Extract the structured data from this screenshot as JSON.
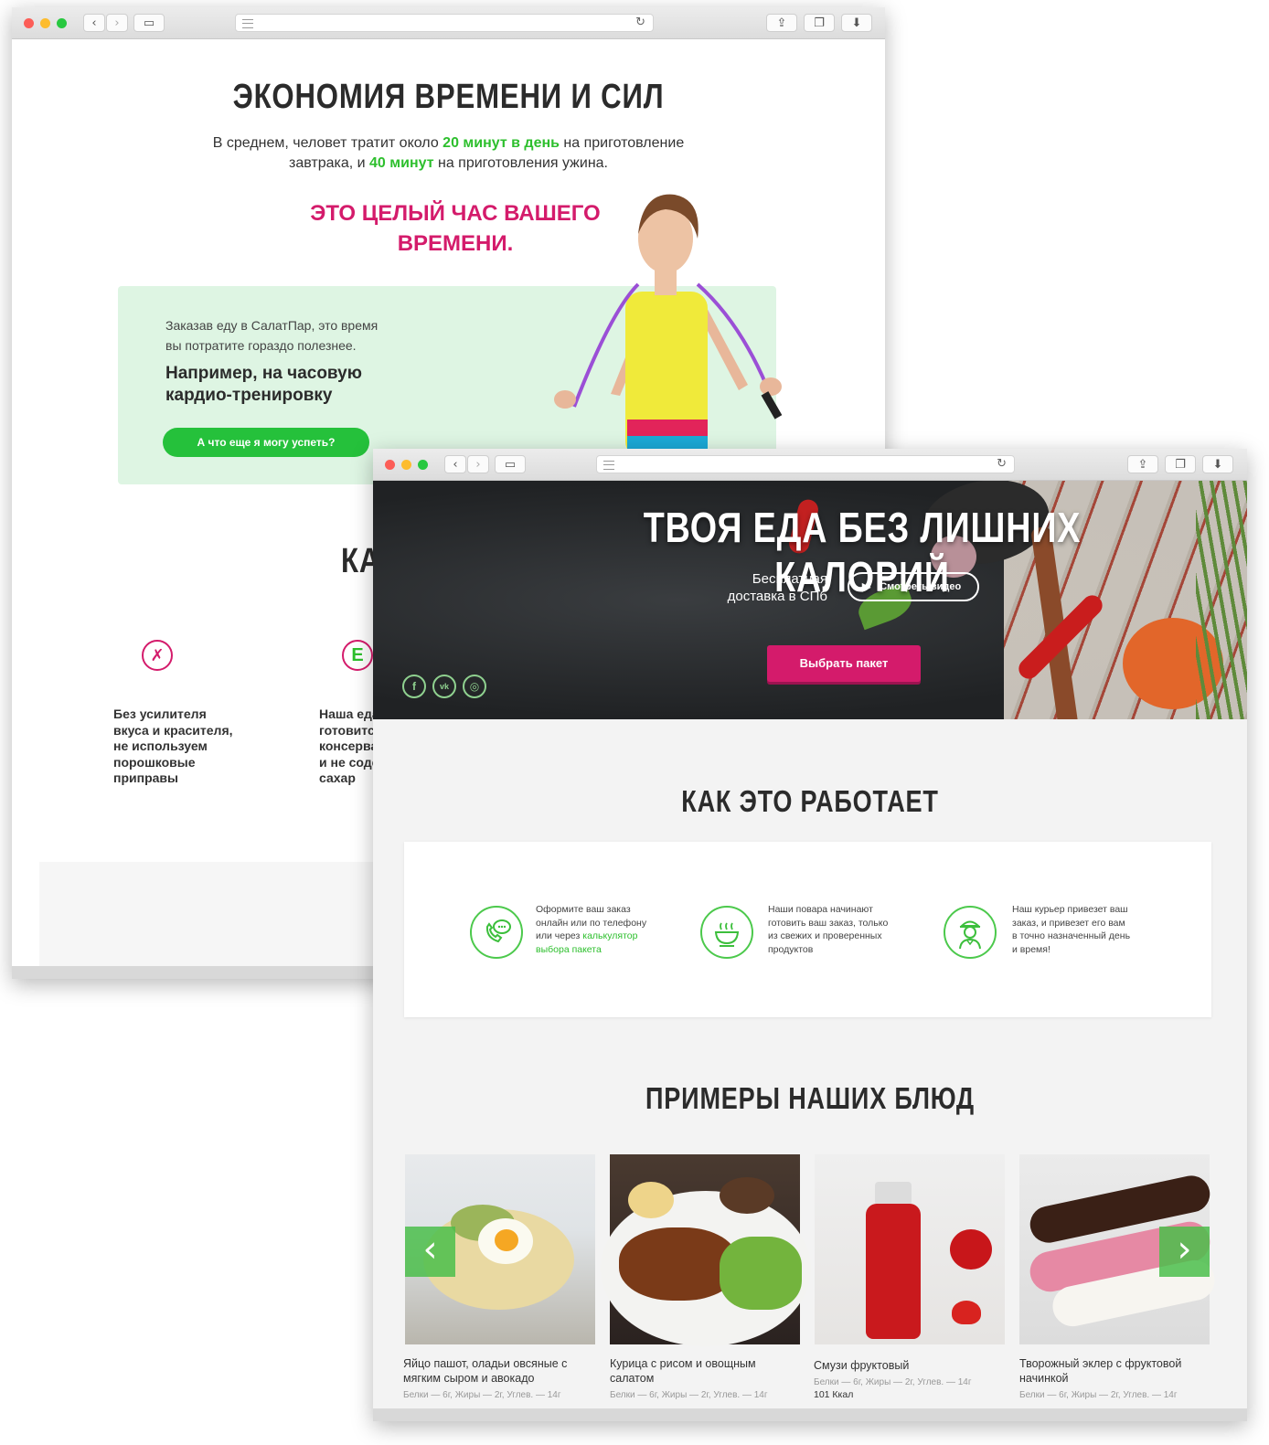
{
  "back_window": {
    "section_title": "ЭКОНОМИЯ ВРЕМЕНИ И СИЛ",
    "intro": {
      "part1": "В среднем, человет тратит около ",
      "hl1": "20 минут в день",
      "part2": " на приготовление",
      "part3": "завтрака, и ",
      "hl2": "40 минут",
      "part4": " на приготовления ужина."
    },
    "headline_line1": "ЭТО ЦЕЛЫЙ ЧАС ВАШЕГО",
    "headline_line2": "ВРЕМЕНИ.",
    "card_text_line1": "Заказав еду в СалатПар, это время",
    "card_text_line2": "вы потратите гораздо полезнее.",
    "card_bold_line1": "Например, на часовую",
    "card_bold_line2": "кардио-тренировку",
    "card_button": "А что еще я могу успеть?",
    "partial_heading": "КА",
    "features": [
      {
        "icon": "no-flavor-icon",
        "glyph": "✗",
        "lines": [
          "Без усилителя",
          "вкуса и красителя,",
          "не используем",
          "порошковые",
          "приправы"
        ]
      },
      {
        "icon": "no-e-additives-icon",
        "glyph": "E",
        "lines": [
          "Наша еда",
          "готовитс",
          "консерва",
          "и не соде",
          "сахар"
        ]
      }
    ]
  },
  "front_window": {
    "hero": {
      "title": "ТВОЯ ЕДА БЕЗ ЛИШНИХ КАЛОРИЙ",
      "delivery_line1": "Бесплатная",
      "delivery_line2": "доставка в СПб",
      "video_button": "Смотреть видео",
      "cta_button": "Выбрать пакет",
      "social": [
        {
          "name": "facebook-icon",
          "glyph": "f"
        },
        {
          "name": "vk-icon",
          "glyph": "vk"
        },
        {
          "name": "instagram-icon",
          "glyph": "◎"
        }
      ]
    },
    "how_title": "КАК ЭТО РАБОТАЕТ",
    "steps": [
      {
        "icon": "phone-chat-icon",
        "lines": [
          "Оформите ваш заказ",
          "онлайн или по телефону",
          "или через "
        ],
        "link_part1": "калькулятор",
        "link_part2": "выбора пакета"
      },
      {
        "icon": "bowl-icon",
        "lines": [
          "Наши повара начинают",
          "готовить ваш заказ, только",
          "из свежих и проверенных",
          "продуктов"
        ]
      },
      {
        "icon": "courier-icon",
        "lines": [
          "Наш курьер привезет ваш",
          "заказ, и привезет его вам",
          "в точно назначенный день",
          "и время!"
        ]
      }
    ],
    "examples_title": "ПРИМЕРЫ НАШИХ БЛЮД",
    "dishes": [
      {
        "name_line1": "Яйцо пашот, оладьи овсяные с",
        "name_line2": "мягким сыром и авокадо",
        "nutrition": "Белки — 6г, Жиры — 2г, Углев. — 14г",
        "kcal": ""
      },
      {
        "name_line1": "Курица с рисом и овощным",
        "name_line2": "салатом",
        "nutrition": "Белки — 6г, Жиры — 2г, Углев. — 14г",
        "kcal": ""
      },
      {
        "name_line1": "Смузи фруктовый",
        "name_line2": "",
        "nutrition": "Белки — 6г, Жиры — 2г, Углев. — 14г",
        "kcal": "101 Ккал"
      },
      {
        "name_line1": "Творожный эклер с фруктовой",
        "name_line2": "начинкой",
        "nutrition": "Белки — 6г, Жиры — 2г, Углев. — 14г",
        "kcal": ""
      }
    ],
    "carousel": {
      "prev": "‹",
      "next": "›"
    }
  },
  "colors": {
    "accent_green": "#2dbf2d",
    "accent_pink": "#d41b6b",
    "card_green": "#def5e3",
    "dark_text": "#2b2b2b"
  }
}
